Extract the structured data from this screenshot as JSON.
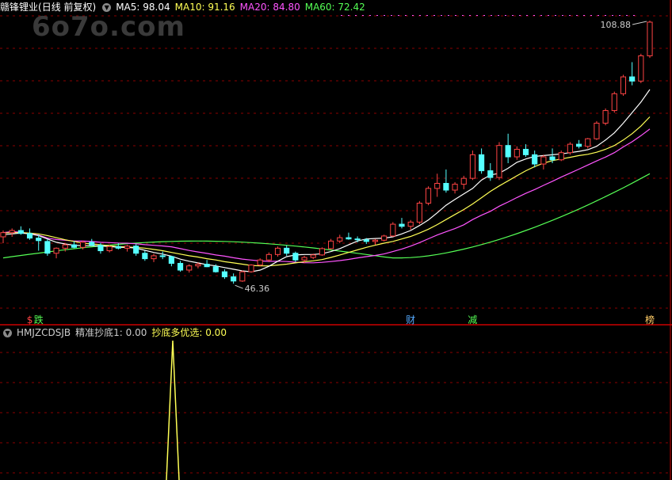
{
  "watermark": "6o7o.com",
  "main_header": {
    "stock_name": "赣锋锂业",
    "period": "(日线 前复权)",
    "ma": [
      {
        "label": "MA5: 98.04",
        "color": "#ffffff"
      },
      {
        "label": "MA10: 91.16",
        "color": "#ffff55"
      },
      {
        "label": "MA20: 84.80",
        "color": "#ff55ff"
      },
      {
        "label": "MA60: 72.42",
        "color": "#55ff55"
      }
    ]
  },
  "indicator_header": {
    "name": "HMJZCDSJB",
    "items": [
      {
        "label": "精准抄底1: 0.00",
        "color": "#cccccc"
      },
      {
        "label": "抄底多优选: 0.00",
        "color": "#ffff55"
      }
    ]
  },
  "colors": {
    "up": "#ff4444",
    "down": "#55ffff",
    "grid": "#8b0000",
    "divider": "#cc0000",
    "ma5": "#ffffff",
    "ma10": "#ffff55",
    "ma20": "#ff55ff",
    "ma60": "#55ff55"
  },
  "chart_data": {
    "type": "candlestick",
    "price_range": [
      40,
      110
    ],
    "annotations": [
      {
        "text": "108.88",
        "type": "high",
        "index": 73
      },
      {
        "text": "46.36",
        "type": "low",
        "index": 26
      }
    ],
    "markers": [
      {
        "text": "$",
        "index": 3,
        "color": "#ff4444"
      },
      {
        "text": "跌",
        "index": 4,
        "color": "#55ff55"
      },
      {
        "text": "财",
        "index": 46,
        "color": "#55aaff"
      },
      {
        "text": "减",
        "index": 53,
        "color": "#55ff55"
      },
      {
        "text": "榜",
        "index": 73,
        "color": "#ffcc66"
      }
    ],
    "candles": [
      [
        57.5,
        59.0,
        56.0,
        58.5
      ],
      [
        58.5,
        59.5,
        57.5,
        59.0
      ],
      [
        59.0,
        60.0,
        58.0,
        58.3
      ],
      [
        58.3,
        59.5,
        56.8,
        57.2
      ],
      [
        57.2,
        58.0,
        54.2,
        56.6
      ],
      [
        56.4,
        57.0,
        53.0,
        53.6
      ],
      [
        53.6,
        55.0,
        52.4,
        54.8
      ],
      [
        54.8,
        56.0,
        54.0,
        55.6
      ],
      [
        55.6,
        56.5,
        54.8,
        55.0
      ],
      [
        55.0,
        56.6,
        54.5,
        56.2
      ],
      [
        56.2,
        57.0,
        55.3,
        55.5
      ],
      [
        55.5,
        56.0,
        53.5,
        54.2
      ],
      [
        54.2,
        55.6,
        53.8,
        55.2
      ],
      [
        55.2,
        56.0,
        54.5,
        54.8
      ],
      [
        54.8,
        55.6,
        54.0,
        55.3
      ],
      [
        55.3,
        55.8,
        53.0,
        53.6
      ],
      [
        53.6,
        54.2,
        51.8,
        52.3
      ],
      [
        52.3,
        53.5,
        51.5,
        53.0
      ],
      [
        53.0,
        54.0,
        52.2,
        52.8
      ],
      [
        52.8,
        53.0,
        50.5,
        51.2
      ],
      [
        51.2,
        51.8,
        49.2,
        49.6
      ],
      [
        49.6,
        51.0,
        49.0,
        50.6
      ],
      [
        50.6,
        51.4,
        50.0,
        51.0
      ],
      [
        51.0,
        52.0,
        50.3,
        50.4
      ],
      [
        50.4,
        51.0,
        49.0,
        49.2
      ],
      [
        49.2,
        49.8,
        47.5,
        48.0
      ],
      [
        48.0,
        48.8,
        46.36,
        47.0
      ],
      [
        47.0,
        49.5,
        46.8,
        49.2
      ],
      [
        49.2,
        51.0,
        49.0,
        50.8
      ],
      [
        50.8,
        52.4,
        50.5,
        52.0
      ],
      [
        52.0,
        53.8,
        51.5,
        53.3
      ],
      [
        53.3,
        55.2,
        52.8,
        54.8
      ],
      [
        54.8,
        55.5,
        53.0,
        53.6
      ],
      [
        53.6,
        54.0,
        51.5,
        52.0
      ],
      [
        52.0,
        53.0,
        51.2,
        52.6
      ],
      [
        52.6,
        53.5,
        52.2,
        53.2
      ],
      [
        53.2,
        55.0,
        53.0,
        54.7
      ],
      [
        54.7,
        57.0,
        54.5,
        56.5
      ],
      [
        56.5,
        58.0,
        56.0,
        57.3
      ],
      [
        57.3,
        58.5,
        56.8,
        57.0
      ],
      [
        57.0,
        57.6,
        56.2,
        56.8
      ],
      [
        56.8,
        57.2,
        55.8,
        56.4
      ],
      [
        56.4,
        57.0,
        55.6,
        56.7
      ],
      [
        56.7,
        58.0,
        56.4,
        57.7
      ],
      [
        57.7,
        61.0,
        57.5,
        60.5
      ],
      [
        60.5,
        62.0,
        59.5,
        60.0
      ],
      [
        60.0,
        61.5,
        59.2,
        61.0
      ],
      [
        61.0,
        66.0,
        60.5,
        65.5
      ],
      [
        65.5,
        69.5,
        65.0,
        69.0
      ],
      [
        69.0,
        72.5,
        67.0,
        70.2
      ],
      [
        70.2,
        73.5,
        68.0,
        68.6
      ],
      [
        68.6,
        70.5,
        67.8,
        70.0
      ],
      [
        70.0,
        72.0,
        68.8,
        71.4
      ],
      [
        71.4,
        78.0,
        71.0,
        77.0
      ],
      [
        77.0,
        78.5,
        72.5,
        73.2
      ],
      [
        73.2,
        75.0,
        70.8,
        71.6
      ],
      [
        71.6,
        80.0,
        71.0,
        79.2
      ],
      [
        79.2,
        82.0,
        75.0,
        76.5
      ],
      [
        76.5,
        79.0,
        75.8,
        78.3
      ],
      [
        78.3,
        79.5,
        76.5,
        77.0
      ],
      [
        77.0,
        78.0,
        74.0,
        74.8
      ],
      [
        74.8,
        77.0,
        73.5,
        76.5
      ],
      [
        76.5,
        78.5,
        75.0,
        75.8
      ],
      [
        75.8,
        78.0,
        75.5,
        77.5
      ],
      [
        77.5,
        80.0,
        77.0,
        79.5
      ],
      [
        79.5,
        80.5,
        78.5,
        79.0
      ],
      [
        79.0,
        81.0,
        78.5,
        80.8
      ],
      [
        80.8,
        85.0,
        80.5,
        84.5
      ],
      [
        84.5,
        88.0,
        84.0,
        87.5
      ],
      [
        87.5,
        92.0,
        87.0,
        91.5
      ],
      [
        91.5,
        96.0,
        91.0,
        95.5
      ],
      [
        95.5,
        99.0,
        93.5,
        94.5
      ],
      [
        94.5,
        101.0,
        94.0,
        100.5
      ],
      [
        100.5,
        108.88,
        100.0,
        108.5
      ]
    ],
    "ma5": [
      58.0,
      58.2,
      58.4,
      58.2,
      57.8,
      57.0,
      56.2,
      55.8,
      55.5,
      55.4,
      55.4,
      55.3,
      55.2,
      55.0,
      55.0,
      54.8,
      54.3,
      53.8,
      53.4,
      52.9,
      52.2,
      51.7,
      51.3,
      50.9,
      50.6,
      50.2,
      49.8,
      49.4,
      49.2,
      49.6,
      50.5,
      51.7,
      52.8,
      53.2,
      53.3,
      53.3,
      53.5,
      54.0,
      54.7,
      55.6,
      56.5,
      57.0,
      57.1,
      57.2,
      57.5,
      58.2,
      59.0,
      60.2,
      61.5,
      63.2,
      65.0,
      66.4,
      67.7,
      69.0,
      71.0,
      72.2,
      72.6,
      73.8,
      75.2,
      76.0,
      76.6,
      76.8,
      77.0,
      77.2,
      77.5,
      77.8,
      78.2,
      79.0,
      80.5,
      82.2,
      84.5,
      87.0,
      89.5,
      92.5
    ],
    "ma10": [
      58.4,
      58.5,
      58.5,
      58.4,
      58.2,
      57.8,
      57.3,
      56.8,
      56.4,
      56.0,
      55.8,
      55.6,
      55.4,
      55.2,
      55.1,
      55.0,
      54.8,
      54.5,
      54.2,
      53.8,
      53.4,
      53.0,
      52.7,
      52.3,
      52.0,
      51.6,
      51.3,
      51.0,
      50.7,
      50.6,
      50.6,
      50.8,
      51.0,
      51.3,
      51.6,
      51.8,
      52.1,
      52.6,
      53.2,
      53.8,
      54.4,
      55.0,
      55.5,
      56.0,
      56.4,
      57.0,
      57.6,
      58.4,
      59.3,
      60.4,
      61.6,
      62.8,
      64.0,
      65.3,
      66.8,
      68.3,
      69.6,
      70.8,
      72.0,
      73.2,
      74.2,
      75.0,
      75.6,
      76.0,
      76.4,
      76.8,
      77.1,
      77.6,
      78.3,
      79.2,
      80.5,
      82.0,
      83.8,
      86.0
    ]
  }
}
